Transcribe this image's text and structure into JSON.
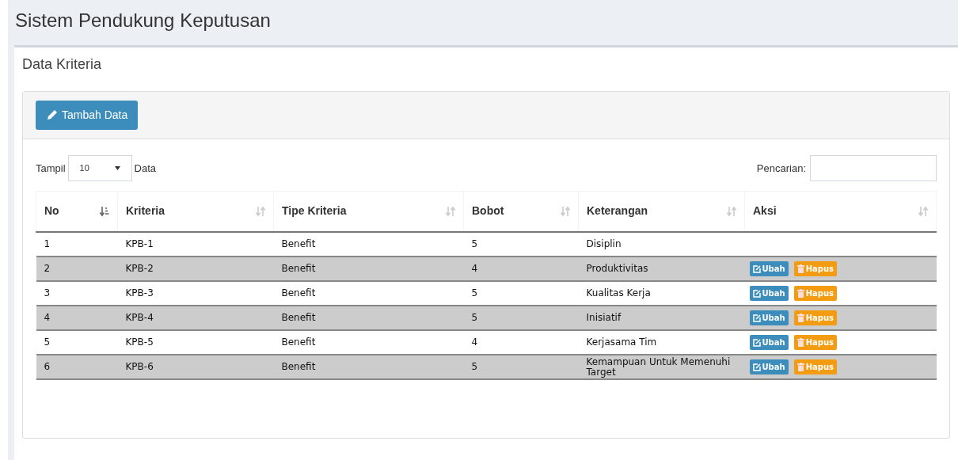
{
  "app_title": "Sistem Pendukung Keputusan",
  "section_title": "Data Kriteria",
  "add_button": "Tambah Data",
  "length_control": {
    "label_before": "Tampil",
    "value": "10",
    "label_after": "Data"
  },
  "search": {
    "label": "Pencarian:"
  },
  "table": {
    "columns": [
      {
        "label": "No",
        "sorted": true
      },
      {
        "label": "Kriteria",
        "sorted": false
      },
      {
        "label": "Tipe Kriteria",
        "sorted": false
      },
      {
        "label": "Bobot",
        "sorted": false
      },
      {
        "label": "Keterangan",
        "sorted": false
      },
      {
        "label": "Aksi",
        "sorted": false
      }
    ],
    "rows": [
      {
        "cells": [
          "1",
          "KPB-1",
          "Benefit",
          "5",
          "Disiplin"
        ]
      },
      {
        "cells": [
          "2",
          "KPB-2",
          "Benefit",
          "4",
          "Produktivitas"
        ],
        "actions": [
          {
            "kind": "edit",
            "label": "Ubah"
          },
          {
            "kind": "delete",
            "label": "Hapus"
          }
        ]
      },
      {
        "cells": [
          "3",
          "KPB-3",
          "Benefit",
          "5",
          "Kualitas Kerja"
        ],
        "actions": [
          {
            "kind": "edit",
            "label": "Ubah"
          },
          {
            "kind": "delete",
            "label": "Hapus"
          }
        ]
      },
      {
        "cells": [
          "4",
          "KPB-4",
          "Benefit",
          "5",
          "Inisiatif"
        ],
        "actions": [
          {
            "kind": "edit",
            "label": "Ubah"
          },
          {
            "kind": "delete",
            "label": "Hapus"
          }
        ]
      },
      {
        "cells": [
          "5",
          "KPB-5",
          "Benefit",
          "4",
          "Kerjasama Tim"
        ],
        "actions": [
          {
            "kind": "edit",
            "label": "Ubah"
          },
          {
            "kind": "delete",
            "label": "Hapus"
          }
        ]
      },
      {
        "cells": [
          "6",
          "KPB-6",
          "Benefit",
          "5",
          "Kemampuan Untuk Memenuhi Target"
        ],
        "actions": [
          {
            "kind": "edit",
            "label": "Ubah"
          },
          {
            "kind": "delete",
            "label": "Hapus"
          }
        ]
      }
    ]
  }
}
